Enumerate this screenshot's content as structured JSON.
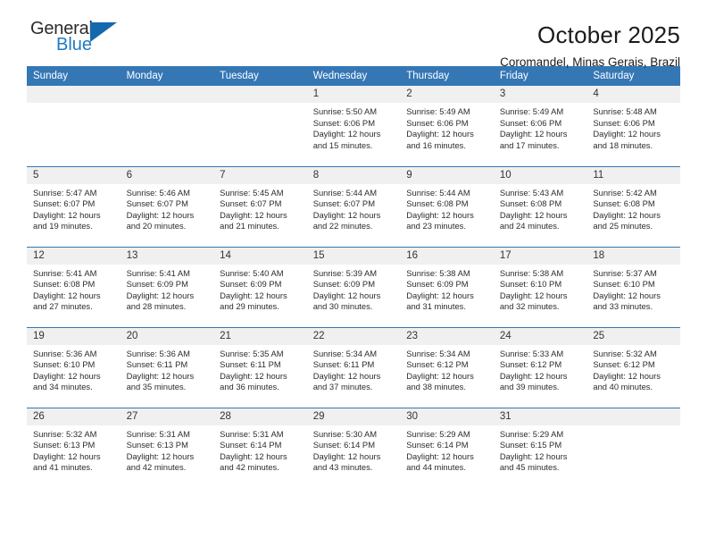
{
  "brand": {
    "name_top": "General",
    "name_bottom": "Blue",
    "logo_icon": "blue-triangle-icon",
    "accent_color": "#1f7ac4",
    "header_color": "#3577b5"
  },
  "header": {
    "title": "October 2025",
    "subtitle": "Coromandel, Minas Gerais, Brazil"
  },
  "weekday_headers": [
    "Sunday",
    "Monday",
    "Tuesday",
    "Wednesday",
    "Thursday",
    "Friday",
    "Saturday"
  ],
  "labels": {
    "sunrise_prefix": "Sunrise:",
    "sunset_prefix": "Sunset:",
    "daylight_prefix": "Daylight:"
  },
  "weeks": [
    [
      {
        "empty": true
      },
      {
        "empty": true
      },
      {
        "empty": true
      },
      {
        "day": "1",
        "sunrise": "Sunrise: 5:50 AM",
        "sunset": "Sunset: 6:06 PM",
        "daylight_line1": "Daylight: 12 hours",
        "daylight_line2": "and 15 minutes."
      },
      {
        "day": "2",
        "sunrise": "Sunrise: 5:49 AM",
        "sunset": "Sunset: 6:06 PM",
        "daylight_line1": "Daylight: 12 hours",
        "daylight_line2": "and 16 minutes."
      },
      {
        "day": "3",
        "sunrise": "Sunrise: 5:49 AM",
        "sunset": "Sunset: 6:06 PM",
        "daylight_line1": "Daylight: 12 hours",
        "daylight_line2": "and 17 minutes."
      },
      {
        "day": "4",
        "sunrise": "Sunrise: 5:48 AM",
        "sunset": "Sunset: 6:06 PM",
        "daylight_line1": "Daylight: 12 hours",
        "daylight_line2": "and 18 minutes."
      }
    ],
    [
      {
        "day": "5",
        "sunrise": "Sunrise: 5:47 AM",
        "sunset": "Sunset: 6:07 PM",
        "daylight_line1": "Daylight: 12 hours",
        "daylight_line2": "and 19 minutes."
      },
      {
        "day": "6",
        "sunrise": "Sunrise: 5:46 AM",
        "sunset": "Sunset: 6:07 PM",
        "daylight_line1": "Daylight: 12 hours",
        "daylight_line2": "and 20 minutes."
      },
      {
        "day": "7",
        "sunrise": "Sunrise: 5:45 AM",
        "sunset": "Sunset: 6:07 PM",
        "daylight_line1": "Daylight: 12 hours",
        "daylight_line2": "and 21 minutes."
      },
      {
        "day": "8",
        "sunrise": "Sunrise: 5:44 AM",
        "sunset": "Sunset: 6:07 PM",
        "daylight_line1": "Daylight: 12 hours",
        "daylight_line2": "and 22 minutes."
      },
      {
        "day": "9",
        "sunrise": "Sunrise: 5:44 AM",
        "sunset": "Sunset: 6:08 PM",
        "daylight_line1": "Daylight: 12 hours",
        "daylight_line2": "and 23 minutes."
      },
      {
        "day": "10",
        "sunrise": "Sunrise: 5:43 AM",
        "sunset": "Sunset: 6:08 PM",
        "daylight_line1": "Daylight: 12 hours",
        "daylight_line2": "and 24 minutes."
      },
      {
        "day": "11",
        "sunrise": "Sunrise: 5:42 AM",
        "sunset": "Sunset: 6:08 PM",
        "daylight_line1": "Daylight: 12 hours",
        "daylight_line2": "and 25 minutes."
      }
    ],
    [
      {
        "day": "12",
        "sunrise": "Sunrise: 5:41 AM",
        "sunset": "Sunset: 6:08 PM",
        "daylight_line1": "Daylight: 12 hours",
        "daylight_line2": "and 27 minutes."
      },
      {
        "day": "13",
        "sunrise": "Sunrise: 5:41 AM",
        "sunset": "Sunset: 6:09 PM",
        "daylight_line1": "Daylight: 12 hours",
        "daylight_line2": "and 28 minutes."
      },
      {
        "day": "14",
        "sunrise": "Sunrise: 5:40 AM",
        "sunset": "Sunset: 6:09 PM",
        "daylight_line1": "Daylight: 12 hours",
        "daylight_line2": "and 29 minutes."
      },
      {
        "day": "15",
        "sunrise": "Sunrise: 5:39 AM",
        "sunset": "Sunset: 6:09 PM",
        "daylight_line1": "Daylight: 12 hours",
        "daylight_line2": "and 30 minutes."
      },
      {
        "day": "16",
        "sunrise": "Sunrise: 5:38 AM",
        "sunset": "Sunset: 6:09 PM",
        "daylight_line1": "Daylight: 12 hours",
        "daylight_line2": "and 31 minutes."
      },
      {
        "day": "17",
        "sunrise": "Sunrise: 5:38 AM",
        "sunset": "Sunset: 6:10 PM",
        "daylight_line1": "Daylight: 12 hours",
        "daylight_line2": "and 32 minutes."
      },
      {
        "day": "18",
        "sunrise": "Sunrise: 5:37 AM",
        "sunset": "Sunset: 6:10 PM",
        "daylight_line1": "Daylight: 12 hours",
        "daylight_line2": "and 33 minutes."
      }
    ],
    [
      {
        "day": "19",
        "sunrise": "Sunrise: 5:36 AM",
        "sunset": "Sunset: 6:10 PM",
        "daylight_line1": "Daylight: 12 hours",
        "daylight_line2": "and 34 minutes."
      },
      {
        "day": "20",
        "sunrise": "Sunrise: 5:36 AM",
        "sunset": "Sunset: 6:11 PM",
        "daylight_line1": "Daylight: 12 hours",
        "daylight_line2": "and 35 minutes."
      },
      {
        "day": "21",
        "sunrise": "Sunrise: 5:35 AM",
        "sunset": "Sunset: 6:11 PM",
        "daylight_line1": "Daylight: 12 hours",
        "daylight_line2": "and 36 minutes."
      },
      {
        "day": "22",
        "sunrise": "Sunrise: 5:34 AM",
        "sunset": "Sunset: 6:11 PM",
        "daylight_line1": "Daylight: 12 hours",
        "daylight_line2": "and 37 minutes."
      },
      {
        "day": "23",
        "sunrise": "Sunrise: 5:34 AM",
        "sunset": "Sunset: 6:12 PM",
        "daylight_line1": "Daylight: 12 hours",
        "daylight_line2": "and 38 minutes."
      },
      {
        "day": "24",
        "sunrise": "Sunrise: 5:33 AM",
        "sunset": "Sunset: 6:12 PM",
        "daylight_line1": "Daylight: 12 hours",
        "daylight_line2": "and 39 minutes."
      },
      {
        "day": "25",
        "sunrise": "Sunrise: 5:32 AM",
        "sunset": "Sunset: 6:12 PM",
        "daylight_line1": "Daylight: 12 hours",
        "daylight_line2": "and 40 minutes."
      }
    ],
    [
      {
        "day": "26",
        "sunrise": "Sunrise: 5:32 AM",
        "sunset": "Sunset: 6:13 PM",
        "daylight_line1": "Daylight: 12 hours",
        "daylight_line2": "and 41 minutes."
      },
      {
        "day": "27",
        "sunrise": "Sunrise: 5:31 AM",
        "sunset": "Sunset: 6:13 PM",
        "daylight_line1": "Daylight: 12 hours",
        "daylight_line2": "and 42 minutes."
      },
      {
        "day": "28",
        "sunrise": "Sunrise: 5:31 AM",
        "sunset": "Sunset: 6:14 PM",
        "daylight_line1": "Daylight: 12 hours",
        "daylight_line2": "and 42 minutes."
      },
      {
        "day": "29",
        "sunrise": "Sunrise: 5:30 AM",
        "sunset": "Sunset: 6:14 PM",
        "daylight_line1": "Daylight: 12 hours",
        "daylight_line2": "and 43 minutes."
      },
      {
        "day": "30",
        "sunrise": "Sunrise: 5:29 AM",
        "sunset": "Sunset: 6:14 PM",
        "daylight_line1": "Daylight: 12 hours",
        "daylight_line2": "and 44 minutes."
      },
      {
        "day": "31",
        "sunrise": "Sunrise: 5:29 AM",
        "sunset": "Sunset: 6:15 PM",
        "daylight_line1": "Daylight: 12 hours",
        "daylight_line2": "and 45 minutes."
      },
      {
        "empty": true
      }
    ]
  ]
}
